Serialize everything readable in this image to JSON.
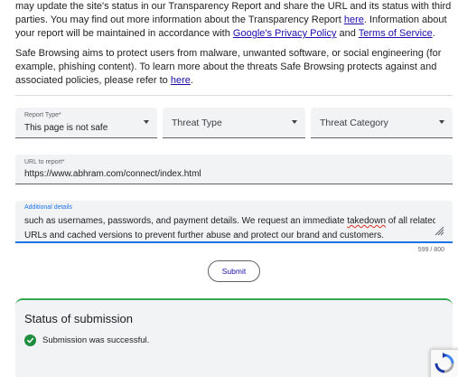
{
  "intro": {
    "p1_text_a": "may update the site's status in our Transparency Report and share the URL and its status with third parties. You may find out more information about the Transparency Report ",
    "p1_link_here": "here",
    "p1_text_b": ". Information about your report will be maintained in accordance with ",
    "p1_link_privacy": "Google's Privacy Policy",
    "p1_text_c": " and ",
    "p1_link_terms": "Terms of Service",
    "p1_text_d": ".",
    "p2_text_a": "Safe Browsing aims to protect users from malware, unwanted software, or social engineering (for example, phishing content). To learn more about the threats Safe Browsing protects against and associated policies, please refer to ",
    "p2_link_here": "here",
    "p2_text_b": "."
  },
  "form": {
    "report_type": {
      "label": "Report Type*",
      "value": "This page is not safe"
    },
    "threat_type": {
      "placeholder": "Threat Type"
    },
    "threat_category": {
      "placeholder": "Threat Category"
    },
    "url": {
      "label": "URL to report*",
      "value": "https://www.abhram.com/connect/index.html"
    },
    "details": {
      "label": "Additional details",
      "line1_a": "such as usernames, passwords, and payment details. We request an immediate ",
      "line1_misspelled": "takedown",
      "line1_b": " of all related",
      "line2": "URLs and cached versions to prevent further abuse and protect our brand and customers."
    },
    "char_counter": "599 / 800",
    "submit_label": "Submit"
  },
  "status": {
    "title": "Status of submission",
    "message": "Submission was successful.",
    "success_color": "#1e8e3e"
  },
  "colors": {
    "link": "#1a0dab",
    "focus": "#1a73e8",
    "field_bg": "#f1f3f4"
  },
  "icons": {
    "dropdown": "caret-down-icon",
    "resize": "resize-handle-icon",
    "status": "check-circle-icon",
    "recaptcha": "recaptcha-icon"
  }
}
